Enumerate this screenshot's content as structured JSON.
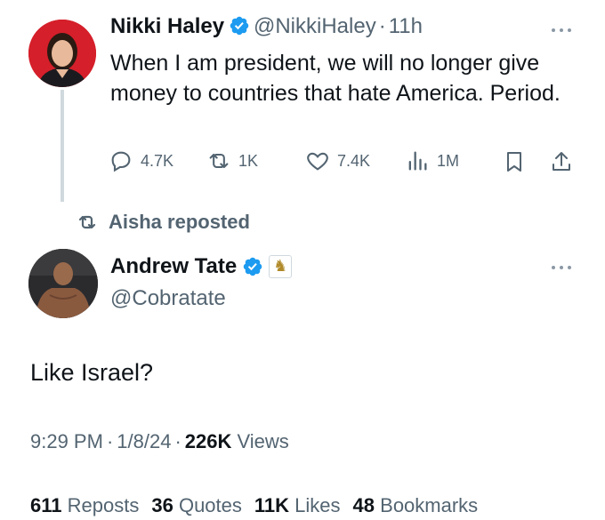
{
  "tweet": {
    "author_name": "Nikki Haley",
    "author_handle": "@NikkiHaley",
    "separator": "·",
    "time": "11h",
    "text": "When I am president, we will no longer give money to countries that hate America. Period.",
    "actions": {
      "replies": "4.7K",
      "reposts": "1K",
      "likes": "7.4K",
      "views": "1M"
    }
  },
  "repost_banner": {
    "text": "Aisha reposted"
  },
  "reply": {
    "author_name": "Andrew Tate",
    "author_handle": "@Cobratate",
    "text": "Like Israel?",
    "time": "9:29 PM",
    "date": "1/8/24",
    "separator": "·",
    "views_count": "226K",
    "views_label": "Views",
    "stats": [
      {
        "count": "611",
        "label": "Reposts"
      },
      {
        "count": "36",
        "label": "Quotes"
      },
      {
        "count": "11K",
        "label": "Likes"
      },
      {
        "count": "48",
        "label": "Bookmarks"
      }
    ]
  },
  "colors": {
    "verified": "#1d9bf0",
    "text": "#0f1419",
    "muted": "#536471",
    "thread_line": "#cfd9de"
  }
}
